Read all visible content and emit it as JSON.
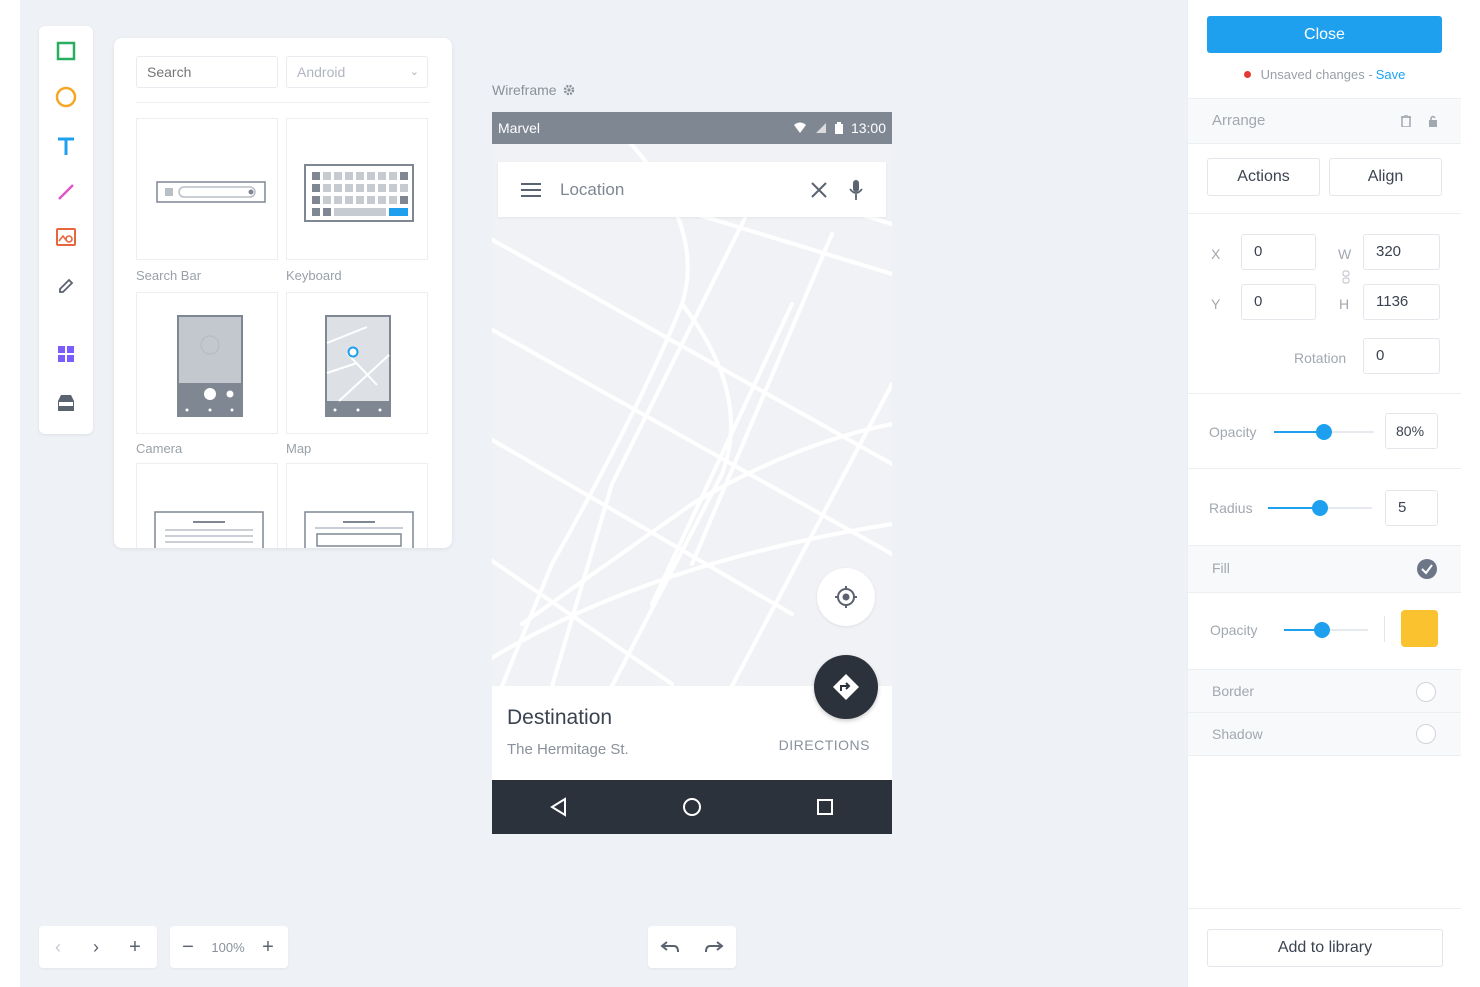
{
  "library": {
    "search_placeholder": "Search",
    "platform": "Android",
    "items": [
      {
        "label": "Search Bar"
      },
      {
        "label": "Keyboard"
      },
      {
        "label": "Camera"
      },
      {
        "label": "Map"
      }
    ]
  },
  "frame": {
    "label": "Wireframe",
    "status": {
      "carrier": "Marvel",
      "time": "13:00"
    },
    "search": {
      "placeholder": "Location"
    },
    "destination": {
      "title": "Destination",
      "address": "The Hermitage St.",
      "action": "DIRECTIONS"
    }
  },
  "bottom": {
    "zoom": "100%"
  },
  "panel": {
    "close": "Close",
    "unsaved": "Unsaved changes - ",
    "save": "Save",
    "arrange": "Arrange",
    "actions": "Actions",
    "align": "Align",
    "x_label": "X",
    "x": "0",
    "y_label": "Y",
    "y": "0",
    "w_label": "W",
    "w": "320",
    "h_label": "H",
    "h": "1136",
    "rotation_label": "Rotation",
    "rotation": "0",
    "opacity_label": "Opacity",
    "opacity": "80%",
    "opacity_level": 0.5,
    "radius_label": "Radius",
    "radius": "5",
    "radius_level": 0.5,
    "fill_label": "Fill",
    "fill_opacity_label": "Opacity",
    "fill_opacity_level": 0.45,
    "fill_color": "#f9c22e",
    "border_label": "Border",
    "shadow_label": "Shadow",
    "add_library": "Add to library"
  },
  "colors": {
    "accent": "#1ea0ef",
    "unsaved_dot": "#e53935"
  }
}
